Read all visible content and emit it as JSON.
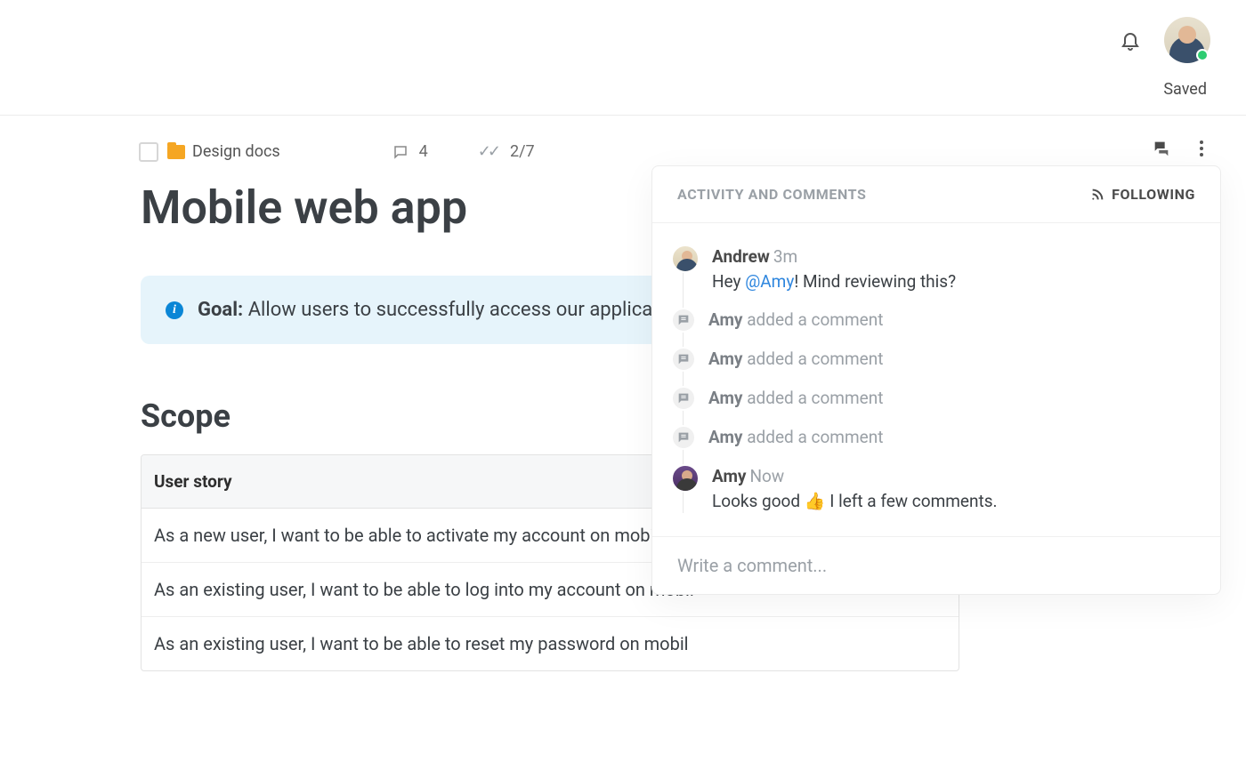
{
  "header": {
    "saved_status": "Saved"
  },
  "breadcrumb": {
    "label": "Design docs"
  },
  "meta": {
    "comment_count": "4",
    "progress": "2/7"
  },
  "page": {
    "title": "Mobile web app"
  },
  "goal": {
    "label": "Goal:",
    "text": "Allow users to successfully access our application"
  },
  "scope": {
    "heading": "Scope",
    "header": "User story",
    "rows": [
      "As a new user, I want to be able to activate my account on mobile.",
      "As an existing user, I want to be able to log into my account on mobil",
      "As an existing user, I want to be able to reset my password on mobil"
    ]
  },
  "comments": {
    "title": "ACTIVITY AND COMMENTS",
    "following_label": "FOLLOWING",
    "input_placeholder": "Write a comment...",
    "entries": [
      {
        "type": "comment",
        "author": "Andrew",
        "avatar": "andrew",
        "time": "3m",
        "message_pre": "Hey ",
        "mention": "@Amy",
        "message_post": "! Mind reviewing this?"
      },
      {
        "type": "activity",
        "author": "Amy",
        "action": "added a comment"
      },
      {
        "type": "activity",
        "author": "Amy",
        "action": "added a comment"
      },
      {
        "type": "activity",
        "author": "Amy",
        "action": "added a comment"
      },
      {
        "type": "activity",
        "author": "Amy",
        "action": "added a comment"
      },
      {
        "type": "comment",
        "author": "Amy",
        "avatar": "amy",
        "time": "Now",
        "message_plain": "Looks good 👍 I left a few comments."
      }
    ]
  }
}
